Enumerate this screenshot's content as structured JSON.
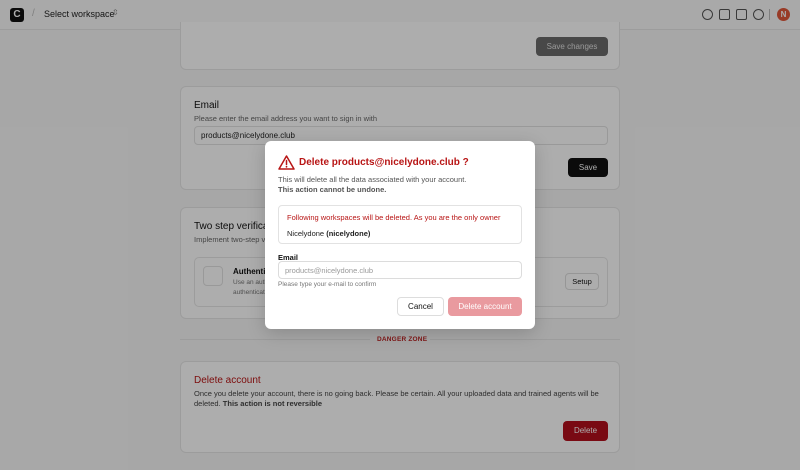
{
  "topbar": {
    "logo_letter": "C",
    "separator": "/",
    "workspace_label": "Select workspace",
    "workspace_chevron": "⇳",
    "icons": [
      "history-icon",
      "gift-icon",
      "book-icon",
      "help-icon"
    ],
    "avatar_letter": "N"
  },
  "profile_card": {
    "save_changes_label": "Save changes"
  },
  "email_card": {
    "title": "Email",
    "subtitle": "Please enter the email address you want to sign in with",
    "email_value": "products@nicelydone.club",
    "save_label": "Save"
  },
  "two_step_card": {
    "title": "Two step verification",
    "subtitle": "Implement two-step verification",
    "auth_title": "Authenticator app",
    "auth_desc_line1": "Use an authenticator app",
    "auth_desc_line2": "authenticate",
    "setup_label": "Setup"
  },
  "danger_zone": {
    "label": "DANGER ZONE"
  },
  "delete_card": {
    "title": "Delete account",
    "description": "Once you delete your account, there is no going back. Please be certain. All your uploaded data and trained agents will be deleted.",
    "description_bold": "This action is not reversible",
    "delete_label": "Delete"
  },
  "modal": {
    "title": "Delete products@nicelydone.club ?",
    "description": "This will delete all the data associated with your account.",
    "warning": "This action cannot be undone.",
    "box_warning": "Following workspaces will be deleted. As you are the only owner",
    "workspace_name": "Nicelydone",
    "workspace_slug": "(nicelydone)",
    "email_label": "Email",
    "email_placeholder": "products@nicelydone.club",
    "email_hint": "Please type your e-mail to confirm",
    "cancel_label": "Cancel",
    "delete_label": "Delete account"
  },
  "colors": {
    "danger": "#b81515",
    "danger_button": "#b3101d",
    "delete_disabled": "#e99a9f"
  }
}
